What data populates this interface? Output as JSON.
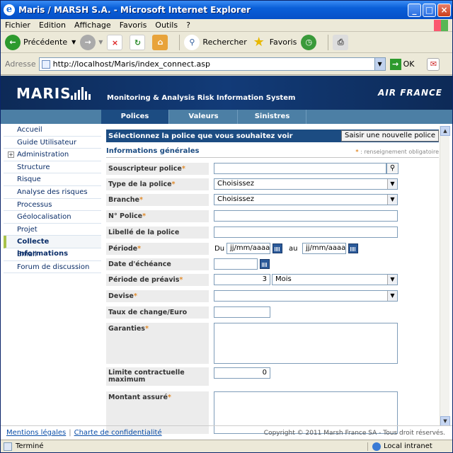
{
  "window": {
    "title": "Maris / MARSH S.A. - Microsoft Internet Explorer"
  },
  "menu": [
    "Fichier",
    "Edition",
    "Affichage",
    "Favoris",
    "Outils",
    "?"
  ],
  "toolbar": {
    "back": "Précédente",
    "search": "Rechercher",
    "favorites": "Favoris"
  },
  "address": {
    "label": "Adresse",
    "url": "http://localhost/Maris/index_connect.asp",
    "go": "OK"
  },
  "banner": {
    "logo": "MARIS",
    "system": "Monitoring & Analysis Risk Information System",
    "partner": "AIR FRANCE"
  },
  "tabs": [
    "Polices",
    "Valeurs",
    "Sinistres"
  ],
  "sidebar": [
    "Accueil",
    "Guide Utilisateur",
    "Administration",
    "Structure",
    "Risque",
    "Analyse des risques",
    "Processus",
    "Géolocalisation",
    "Projet",
    "Collecte informations",
    "Email",
    "Forum de discussion"
  ],
  "main": {
    "select_text": "Sélectionnez la police que vous souhaitez voir",
    "new_policy_button": "Saisir une nouvelle police",
    "section_title": "Informations générales",
    "required_note": "renseignement obligatoire",
    "required_mark": "*",
    "fields": {
      "souscripteur": "Souscripteur police",
      "type": "Type de la police",
      "type_value": "Choisissez",
      "branche": "Branche",
      "branche_value": "Choisissez",
      "numero": "N° Police",
      "libelle": "Libellé de la police",
      "periode": "Période",
      "du": "Du",
      "au": "au",
      "date_placeholder": "jj/mm/aaaa",
      "echeance": "Date d'échéance",
      "preavis": "Période de préavis",
      "preavis_value": "3",
      "preavis_unit": "Mois",
      "devise": "Devise",
      "taux": "Taux de change/Euro",
      "garanties": "Garanties",
      "limite": "Limite contractuelle maximum",
      "limite_value": "0",
      "montant": "Montant assuré"
    }
  },
  "footer": {
    "legal": "Mentions légales",
    "privacy": "Charte de confidentialité",
    "copyright": "Copyright © 2011 Marsh France SA - Tous droit réservés."
  },
  "status": {
    "text": "Terminé",
    "zone": "Local intranet"
  }
}
